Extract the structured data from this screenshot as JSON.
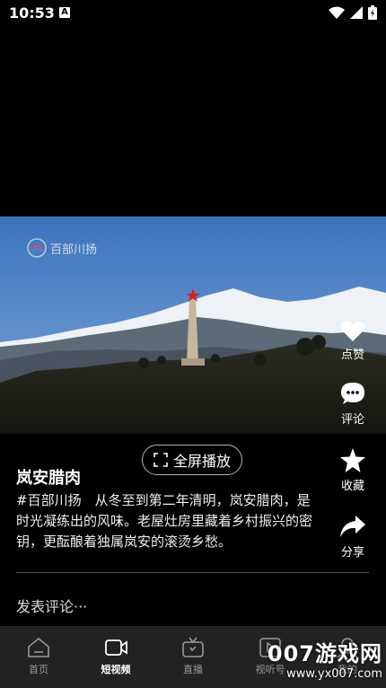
{
  "status_bar": {
    "time": "10:53",
    "notification_icon": "A"
  },
  "video": {
    "watermark": "百部川扬",
    "fullscreen_label": "全屏播放"
  },
  "post": {
    "title": "岚安腊肉",
    "description": "#百部川扬　从冬至到第二年清明，岚安腊肉，是时光凝练出的风味。老屋灶房里藏着乡村振兴的密钥，更酝酿着独属岚安的滚烫乡愁。"
  },
  "actions": {
    "like": "点赞",
    "comment": "评论",
    "favorite": "收藏",
    "share": "分享"
  },
  "comment_placeholder": "发表评论···",
  "tabs": [
    {
      "label": "首页",
      "icon": "home-icon"
    },
    {
      "label": "短视频",
      "icon": "video-camera-icon"
    },
    {
      "label": "直播",
      "icon": "tv-icon"
    },
    {
      "label": "视听号",
      "icon": "play-box-icon"
    },
    {
      "label": "我的",
      "icon": "user-icon"
    }
  ],
  "site_watermark": {
    "big": "007游戏网",
    "small": "www.yx007.com"
  },
  "colors": {
    "background": "#000000",
    "tabbar": "#222222",
    "sky": "#4a7fc0"
  }
}
